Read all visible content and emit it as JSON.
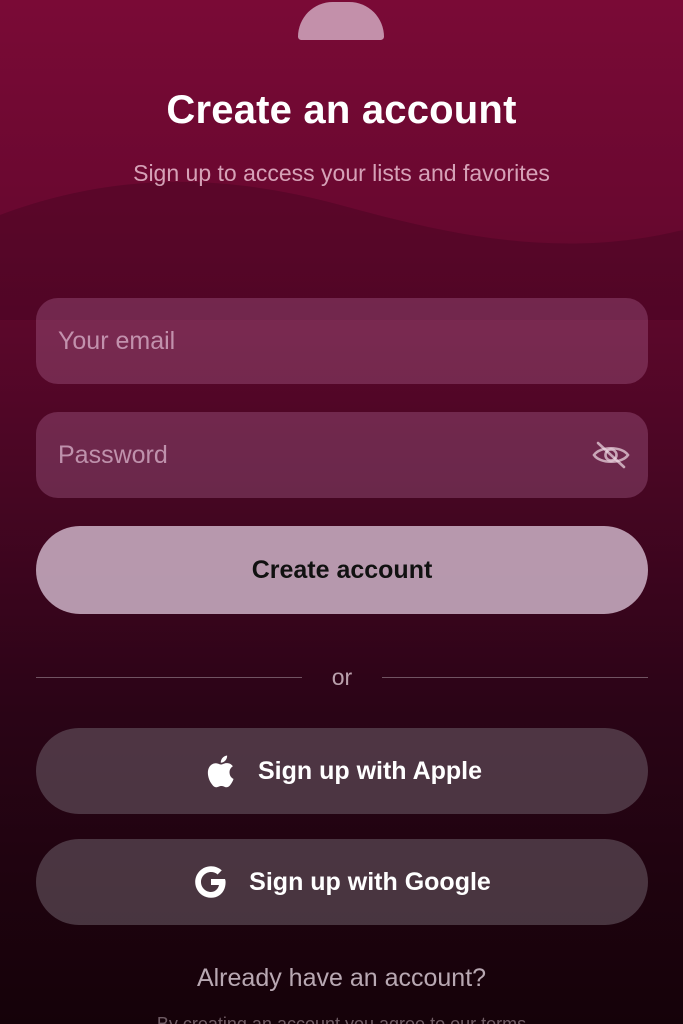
{
  "header": {
    "title": "Create an account",
    "subtitle": "Sign up to access your lists and favorites"
  },
  "form": {
    "email_placeholder": "Your email",
    "email_value": "",
    "password_placeholder": "Password",
    "password_value": "",
    "password_toggle_icon": "eye-slash-icon",
    "submit_label": "Create account"
  },
  "divider": {
    "label": "or"
  },
  "social": {
    "apple_label": "Sign up with Apple",
    "apple_icon": "apple-logo-icon",
    "google_label": "Sign up with Google",
    "google_icon": "google-logo-icon"
  },
  "footer": {
    "signin_prompt": "Already have an account?",
    "terms_text": "By creating an account you agree to our terms"
  },
  "colors": {
    "background_top": "#7a0a36",
    "background_bottom": "#150209",
    "primary_button": "#d2b9cd",
    "social_button": "#6e5f69"
  }
}
